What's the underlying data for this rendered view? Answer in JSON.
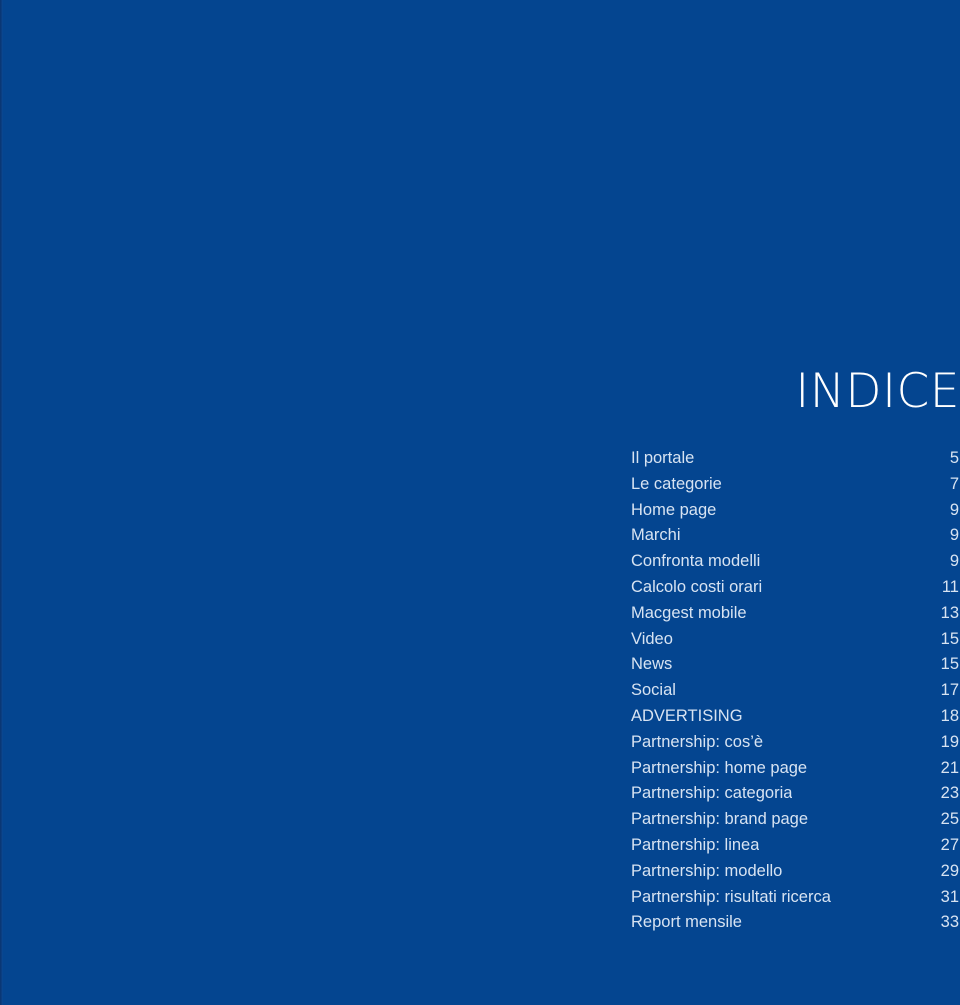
{
  "page": {
    "background_color": "#044590",
    "gutter_color": "#0a3470",
    "text_color": "#d7e3f2",
    "title_color": "#ffffff"
  },
  "title": "INDICE",
  "toc": {
    "entries": [
      {
        "label": "Il portale",
        "page": "5"
      },
      {
        "label": "Le categorie",
        "page": "7"
      },
      {
        "label": "Home page",
        "page": "9"
      },
      {
        "label": "Marchi",
        "page": "9"
      },
      {
        "label": "Confronta modelli",
        "page": "9"
      },
      {
        "label": "Calcolo costi orari",
        "page": "11"
      },
      {
        "label": "Macgest mobile",
        "page": "13"
      },
      {
        "label": "Video",
        "page": "15"
      },
      {
        "label": "News",
        "page": "15"
      },
      {
        "label": "Social",
        "page": "17"
      },
      {
        "label": "ADVERTISING",
        "page": "18"
      },
      {
        "label": "Partnership: cos’è",
        "page": "19"
      },
      {
        "label": "Partnership: home page",
        "page": "21"
      },
      {
        "label": "Partnership: categoria",
        "page": "23"
      },
      {
        "label": "Partnership: brand page",
        "page": "25"
      },
      {
        "label": "Partnership: linea",
        "page": "27"
      },
      {
        "label": "Partnership: modello",
        "page": "29"
      },
      {
        "label": "Partnership: risultati ricerca",
        "page": "31"
      },
      {
        "label": "Report mensile",
        "page": "33"
      }
    ]
  }
}
